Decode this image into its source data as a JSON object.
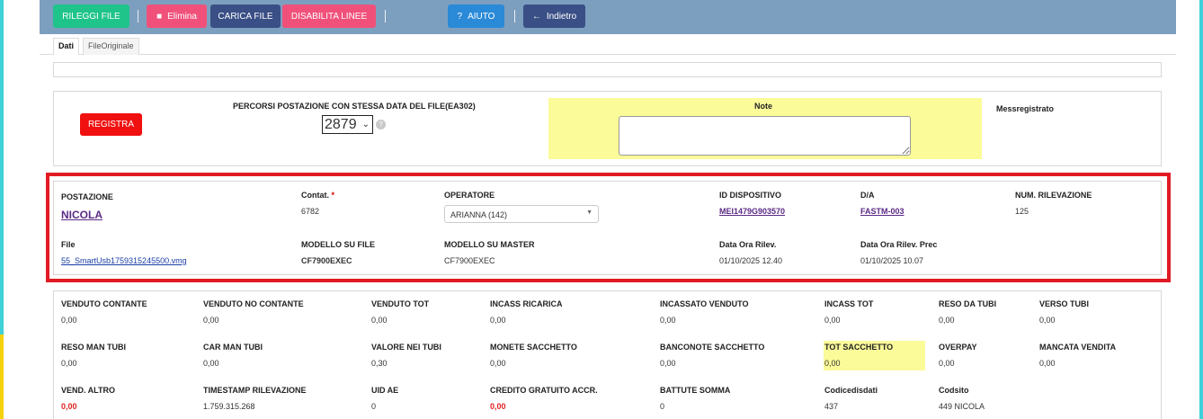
{
  "toolbar": {
    "reload_label": "RILEGGI FILE",
    "delete_label": "Elimina",
    "load_label": "CARICA FILE",
    "disable_label": "DISABILITA LINEE",
    "help_label": "AIUTO",
    "back_label": "Indietro",
    "help_icon": "?",
    "back_icon": "←",
    "delete_icon": "🗑"
  },
  "tabs": [
    {
      "label": "Dati",
      "active": true
    },
    {
      "label": "FileOriginale",
      "active": false
    }
  ],
  "top": {
    "register_label": "REGISTRA",
    "percorsi_label": "PERCORSI POSTAZIONE CON STESSA DATA DEL FILE(EA302)",
    "percorsi_value": "2879",
    "help_icon": "?",
    "note_label": "Note",
    "note_value": "",
    "messregistrato_label": "Messregistrato"
  },
  "info": {
    "postazione_label": "POSTAZIONE",
    "postazione_value": "NICOLA",
    "contat_label": "Contat.",
    "contat_required": "*",
    "contat_value": "6782",
    "operatore_label": "OPERATORE",
    "operatore_value": "ARIANNA (142)",
    "id_dispositivo_label": "ID DISPOSITIVO",
    "id_dispositivo_value": "MEI1479G903570",
    "da_label": "D/A",
    "da_value": "FASTM-003",
    "num_rilevazione_label": "NUM. RILEVAZIONE",
    "num_rilevazione_value": "125",
    "file_label": "File",
    "file_value": "55_SmartUsb1759315245500.vmg",
    "modello_file_label": "MODELLO SU FILE",
    "modello_file_value": "CF7900EXEC",
    "modello_master_label": "MODELLO SU MASTER",
    "modello_master_value": "CF7900EXEC",
    "data_ora_label": "Data Ora Rilev.",
    "data_ora_value": "01/10/2025 12.40",
    "data_ora_prec_label": "Data Ora Rilev. Prec",
    "data_ora_prec_value": "01/10/2025 10.07"
  },
  "stats": {
    "row1": [
      {
        "label": "VENDUTO CONTANTE",
        "value": "0,00"
      },
      {
        "label": "VENDUTO NO CONTANTE",
        "value": "0,00"
      },
      {
        "label": "VENDUTO TOT",
        "value": "0,00"
      },
      {
        "label": "INCASS RICARICA",
        "value": "0,00"
      },
      {
        "label": "INCASSATO VENDUTO",
        "value": "0,00"
      },
      {
        "label": "INCASS TOT",
        "value": "0,00"
      },
      {
        "label": "RESO DA TUBI",
        "value": "0,00"
      },
      {
        "label": "VERSO TUBI",
        "value": "0,00"
      }
    ],
    "row2": [
      {
        "label": "RESO MAN TUBI",
        "value": "0,00"
      },
      {
        "label": "CAR MAN TUBI",
        "value": "0,00"
      },
      {
        "label": "VALORE NEI TUBI",
        "value": "0,30"
      },
      {
        "label": "MONETE SACCHETTO",
        "value": "0,00"
      },
      {
        "label": "BANCONOTE SACCHETTO",
        "value": "0,00"
      },
      {
        "label": "TOT SACCHETTO",
        "value": "0,00"
      },
      {
        "label": "OVERPAY",
        "value": "0,00"
      },
      {
        "label": "MANCATA VENDITA",
        "value": "0,00"
      }
    ],
    "row3": [
      {
        "label": "VEND. ALTRO",
        "value": "0,00"
      },
      {
        "label": "TIMESTAMP RILEVAZIONE",
        "value": "1.759.315.268"
      },
      {
        "label": "UID AE",
        "value": "0"
      },
      {
        "label": "CREDITO GRATUITO ACCR.",
        "value": "0,00"
      },
      {
        "label": "BATTUTE SOMMA",
        "value": "0"
      },
      {
        "label": "Codicedisdati",
        "value": "437"
      },
      {
        "label": "Codsito",
        "value": "449 NICOLA"
      }
    ]
  },
  "colors": {
    "toolbar_bg": "#7d9fbf",
    "btn_green": "#1fc48a",
    "btn_pink": "#f0517a",
    "btn_navy": "#3a4f86",
    "btn_blue": "#2a8ad8",
    "register_red": "#f01010",
    "highlight_frame": "#e21b23",
    "note_yellow": "#fbfb9a"
  }
}
